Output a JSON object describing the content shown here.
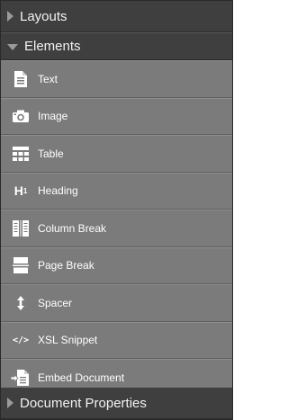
{
  "sections": {
    "layouts": {
      "label": "Layouts"
    },
    "elements": {
      "label": "Elements"
    },
    "document_properties": {
      "label": "Document Properties"
    }
  },
  "elements": {
    "items": [
      {
        "label": "Text",
        "icon": "text-document-icon"
      },
      {
        "label": "Image",
        "icon": "camera-icon"
      },
      {
        "label": "Table",
        "icon": "table-icon"
      },
      {
        "label": "Heading",
        "icon": "heading-icon"
      },
      {
        "label": "Column Break",
        "icon": "column-break-icon"
      },
      {
        "label": "Page Break",
        "icon": "page-break-icon"
      },
      {
        "label": "Spacer",
        "icon": "spacer-icon"
      },
      {
        "label": "XSL Snippet",
        "icon": "code-icon"
      },
      {
        "label": "Embed Document",
        "icon": "embed-document-icon"
      }
    ],
    "heading_icon_text": "H",
    "heading_icon_sup": "1",
    "code_icon_text": "</>"
  },
  "colors": {
    "header_bg": "#3f3f3f",
    "item_bg": "#7b7b7b",
    "caret": "#9a9a9a",
    "text": "#ffffff"
  }
}
